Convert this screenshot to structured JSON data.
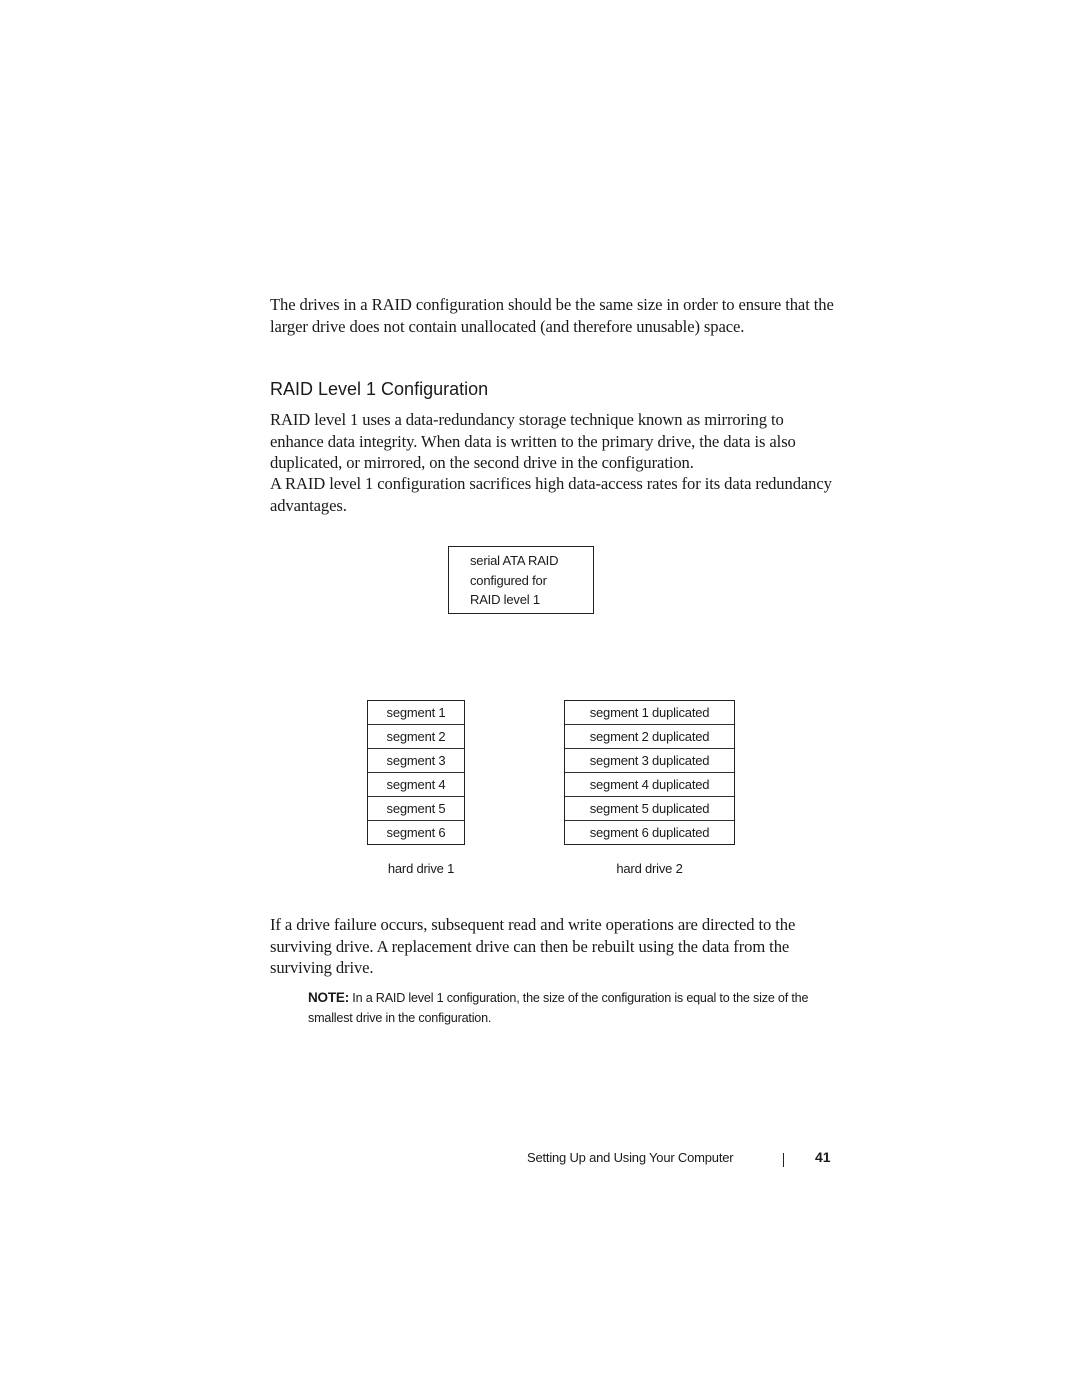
{
  "body": {
    "intro_paragraph": "The drives in a RAID configuration should be the same size in order to ensure that the larger drive does not contain unallocated (and therefore unusable) space.",
    "section_heading": "RAID Level 1 Configuration",
    "section_paragraph_1": "RAID level 1 uses a data-redundancy storage technique known as mirroring to enhance data integrity. When data is written to the primary drive, the data is also duplicated, or mirrored, on the second drive in the configuration.",
    "section_paragraph_2": "A RAID level 1 configuration sacrifices high data-access rates for its data redundancy advantages.",
    "failure_paragraph": "If a drive failure occurs, subsequent read and write operations are directed to the surviving drive. A replacement drive can then be rebuilt using the data from the surviving drive."
  },
  "diagram": {
    "controller_lines": [
      "serial ATA RAID",
      "configured for",
      "RAID level 1"
    ],
    "drive1": {
      "label": "hard drive 1",
      "segments": [
        "segment 1",
        "segment 2",
        "segment 3",
        "segment 4",
        "segment 5",
        "segment 6"
      ]
    },
    "drive2": {
      "label": "hard drive 2",
      "segments": [
        "segment 1 duplicated",
        "segment 2 duplicated",
        "segment 3 duplicated",
        "segment 4 duplicated",
        "segment 5 duplicated",
        "segment 6 duplicated"
      ]
    }
  },
  "note": {
    "label": "NOTE:",
    "text": " In a RAID level 1 configuration, the size of the configuration is equal to the size of the smallest drive in the configuration."
  },
  "footer": {
    "section_title": "Setting Up and Using Your Computer",
    "page_number": "41"
  }
}
